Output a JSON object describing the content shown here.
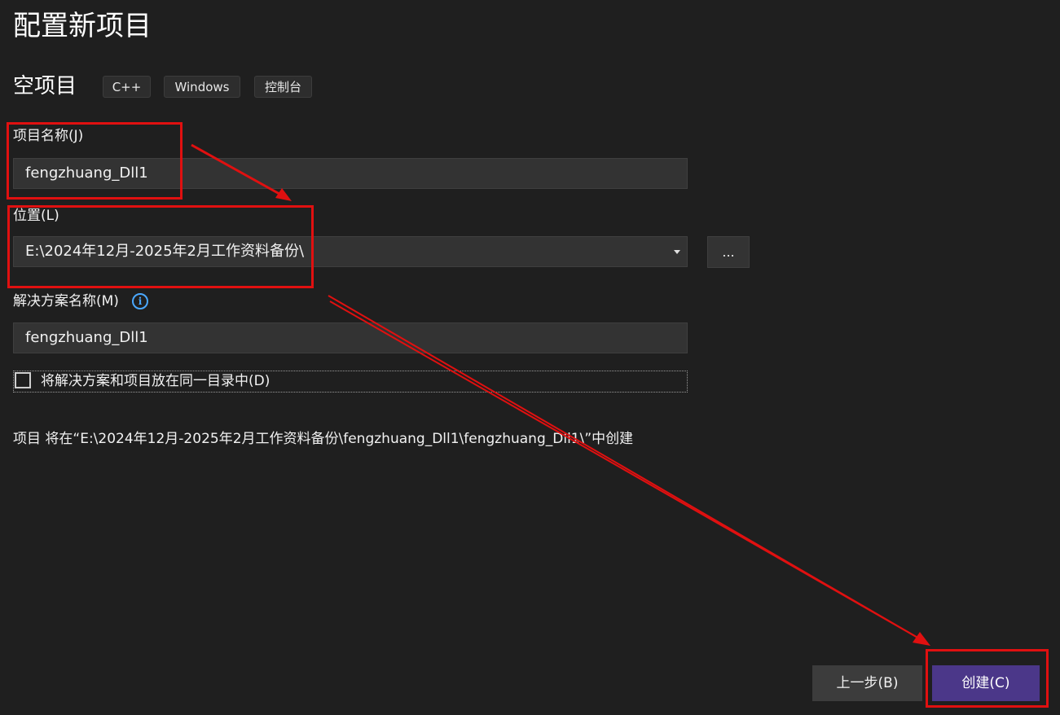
{
  "page_title": "配置新项目",
  "template": {
    "name": "空项目",
    "tags": [
      "C++",
      "Windows",
      "控制台"
    ]
  },
  "project_name": {
    "label": "项目名称(J)",
    "value": "fengzhuang_Dll1"
  },
  "location": {
    "label": "位置(L)",
    "value": "E:\\2024年12月-2025年2月工作资料备份\\",
    "browse_label": "..."
  },
  "solution_name": {
    "label": "解决方案名称(M)",
    "info_icon": "i",
    "value": "fengzhuang_Dll1"
  },
  "same_dir_checkbox": {
    "label": "将解决方案和项目放在同一目录中(D)",
    "checked": false
  },
  "path_note": "项目 将在“E:\\2024年12月-2025年2月工作资料备份\\fengzhuang_Dll1\\fengzhuang_Dll1\\”中创建",
  "buttons": {
    "back_label": "上一步(B)",
    "create_label": "创建(C)"
  },
  "colors": {
    "background": "#1f1f1f",
    "accent_button": "#4b3789",
    "annotation": "#e01010",
    "info": "#4aa8ff"
  },
  "icons": [
    "info-icon",
    "dropdown-caret-icon",
    "annotation-arrow"
  ]
}
